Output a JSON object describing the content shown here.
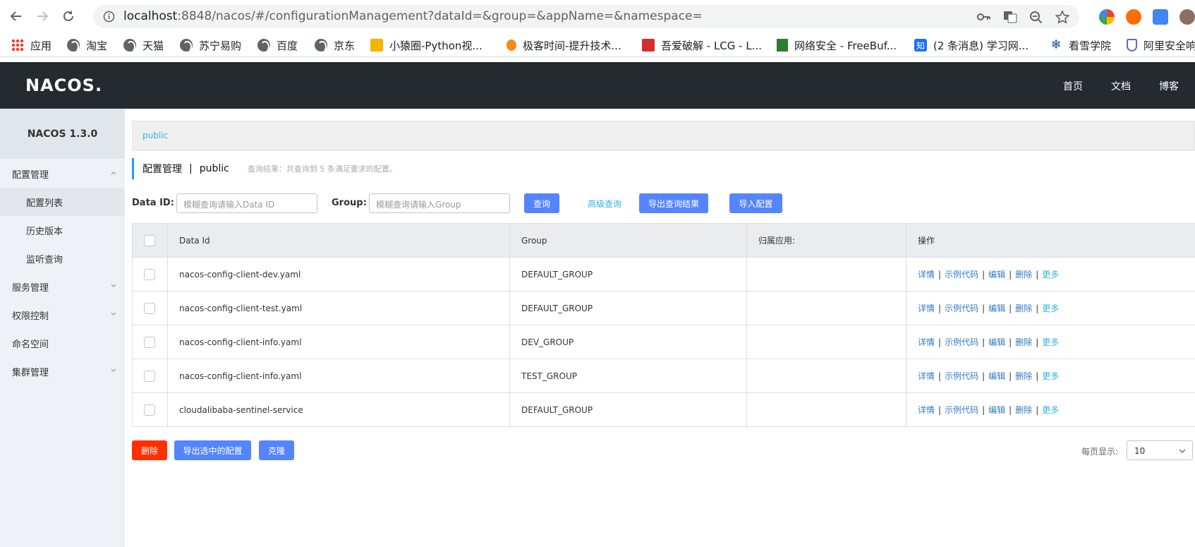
{
  "browser": {
    "url": "localhost:8848/nacos/#/configurationManagement?dataId=&group=&appName=&namespace=",
    "url_host": "localhost",
    "url_rest": ":8848/nacos/#/configurationManagement?dataId=&group=&appName=&namespace="
  },
  "bookmarks": [
    {
      "label": "应用",
      "icon": "apps-grid-icon"
    },
    {
      "label": "淘宝",
      "icon": "globe-icon"
    },
    {
      "label": "天猫",
      "icon": "globe-icon"
    },
    {
      "label": "苏宁易购",
      "icon": "globe-icon"
    },
    {
      "label": "百度",
      "icon": "globe-icon"
    },
    {
      "label": "京东",
      "icon": "globe-icon"
    },
    {
      "label": "小猿圈-Python视...",
      "icon": "site-icon"
    },
    {
      "label": "极客时间-提升技术...",
      "icon": "site-icon"
    },
    {
      "label": "吾爱破解 - LCG - L...",
      "icon": "site-icon"
    },
    {
      "label": "网络安全 - FreeBuf...",
      "icon": "site-icon"
    },
    {
      "label": "(2 条消息) 学习网...",
      "icon": "zhihu-icon"
    },
    {
      "label": "看雪学院",
      "icon": "snowflake-icon"
    },
    {
      "label": "阿里安全响",
      "icon": "shield-icon"
    }
  ],
  "header": {
    "logo": "NACOS.",
    "nav": [
      "首页",
      "文档",
      "博客"
    ]
  },
  "sidebar": {
    "title": "NACOS 1.3.0",
    "items": [
      {
        "label": "配置管理",
        "type": "parent",
        "expanded": true
      },
      {
        "label": "配置列表",
        "type": "child",
        "active": true
      },
      {
        "label": "历史版本",
        "type": "child"
      },
      {
        "label": "监听查询",
        "type": "child"
      },
      {
        "label": "服务管理",
        "type": "parent"
      },
      {
        "label": "权限控制",
        "type": "parent"
      },
      {
        "label": "命名空间",
        "type": "leaf"
      },
      {
        "label": "集群管理",
        "type": "parent"
      }
    ]
  },
  "namespace_bar": {
    "label": "public"
  },
  "page": {
    "title": "配置管理",
    "separator": "|",
    "namespace": "public",
    "result_hint": "查询结果：共查询到 5 条满足要求的配置。"
  },
  "search": {
    "dataid_label": "Data ID:",
    "dataid_placeholder": "模糊查询请输入Data ID",
    "group_label": "Group:",
    "group_placeholder": "模糊查询请输入Group",
    "query_button": "查询",
    "advanced_link": "高级查询",
    "export_button": "导出查询结果",
    "import_button": "导入配置"
  },
  "table": {
    "headers": [
      "Data Id",
      "Group",
      "归属应用:",
      "操作"
    ],
    "rows": [
      {
        "data_id": "nacos-config-client-dev.yaml",
        "group": "DEFAULT_GROUP",
        "app": ""
      },
      {
        "data_id": "nacos-config-client-test.yaml",
        "group": "DEFAULT_GROUP",
        "app": ""
      },
      {
        "data_id": "nacos-config-client-info.yaml",
        "group": "DEV_GROUP",
        "app": ""
      },
      {
        "data_id": "nacos-config-client-info.yaml",
        "group": "TEST_GROUP",
        "app": ""
      },
      {
        "data_id": "cloudalibaba-sentinel-service",
        "group": "DEFAULT_GROUP",
        "app": ""
      }
    ],
    "ops": {
      "detail": "详情",
      "sample": "示例代码",
      "edit": "编辑",
      "delete": "删除",
      "more": "更多",
      "sep": "|"
    }
  },
  "footer": {
    "delete_button": "删除",
    "export_selected_button": "导出选中的配置",
    "clone_button": "克隆",
    "page_size_label": "每页显示:",
    "page_size_value": "10"
  },
  "colors": {
    "header_bg": "#252a2f",
    "primary": "#5584ff",
    "danger": "#ff3000",
    "link": "#33b4e0"
  }
}
